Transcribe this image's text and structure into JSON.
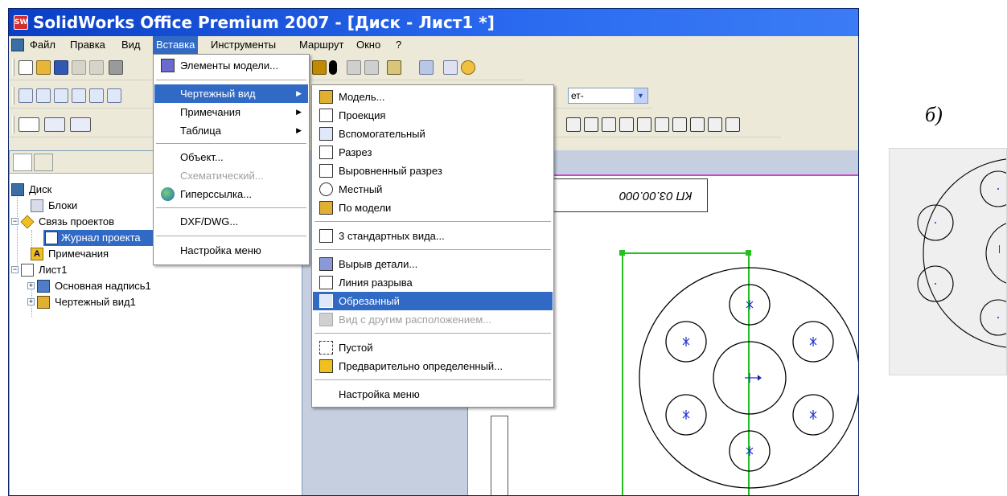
{
  "window": {
    "title": "SolidWorks Office Premium 2007 - [Диск - Лист1 *]",
    "app_icon_text": "SW"
  },
  "menubar": {
    "items": [
      "Файл",
      "Правка",
      "Вид",
      "Вставка",
      "Инструменты",
      "Маршрут",
      "Окно",
      "?"
    ],
    "active": "Вставка"
  },
  "toolbar": {
    "layer_combo_value": "ет-"
  },
  "feature_tree": {
    "items": [
      {
        "label": "Диск"
      },
      {
        "label": "Блоки"
      },
      {
        "label": "Связь проектов"
      },
      {
        "label": "Журнал проекта"
      },
      {
        "label": "Примечания"
      },
      {
        "label": "Лист1"
      },
      {
        "label": "Основная надпись1"
      },
      {
        "label": "Чертежный вид1"
      }
    ]
  },
  "insert_menu": {
    "items": [
      {
        "label": "Элементы модели...",
        "icon": "model-items-icon"
      },
      {
        "label": "Чертежный вид",
        "has_submenu": true,
        "highlighted": true
      },
      {
        "label": "Примечания",
        "has_submenu": true
      },
      {
        "label": "Таблица",
        "has_submenu": true
      },
      {
        "label": "Объект..."
      },
      {
        "label": "Схематический...",
        "disabled": true
      },
      {
        "label": "Гиперссылка...",
        "icon": "globe-icon"
      },
      {
        "label": "DXF/DWG..."
      },
      {
        "label": "Настройка меню"
      }
    ]
  },
  "drawing_view_menu": {
    "items": [
      {
        "label": "Модель...",
        "icon": "model-view-icon"
      },
      {
        "label": "Проекция",
        "icon": "projection-icon"
      },
      {
        "label": "Вспомогательный",
        "icon": "auxiliary-icon"
      },
      {
        "label": "Разрез",
        "icon": "section-icon"
      },
      {
        "label": "Выровненный разрез",
        "icon": "aligned-section-icon"
      },
      {
        "label": "Местный",
        "icon": "detail-icon"
      },
      {
        "label": "По модели",
        "icon": "relative-view-icon"
      },
      {
        "label": "3 стандартных вида...",
        "icon": "standard-views-icon"
      },
      {
        "label": "Вырыв детали...",
        "icon": "broken-out-icon"
      },
      {
        "label": "Линия разрыва",
        "icon": "break-line-icon"
      },
      {
        "label": "Обрезанный",
        "icon": "crop-icon",
        "highlighted": true
      },
      {
        "label": "Вид с другим расположением...",
        "icon": "alternate-position-icon",
        "disabled": true
      },
      {
        "label": "Пустой",
        "icon": "empty-view-icon"
      },
      {
        "label": "Предварительно определенный...",
        "icon": "predefined-icon"
      },
      {
        "label": "Настройка меню"
      }
    ]
  },
  "drawing": {
    "title_block_text": "КП 03.00.000"
  },
  "panel_label": "б)",
  "colors": {
    "highlight": "#316ac5",
    "selection_box": "#22c022",
    "title_bar": "#0a3fc4"
  }
}
